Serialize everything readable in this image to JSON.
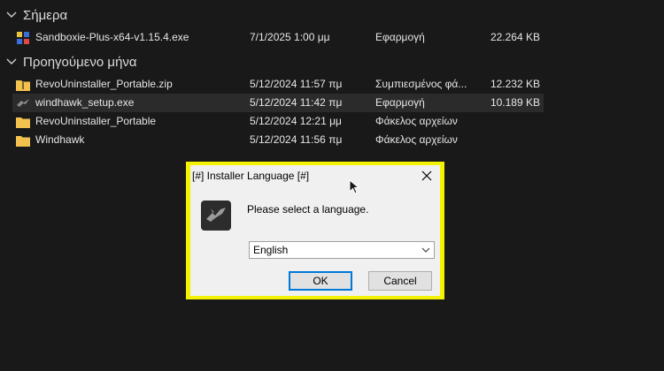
{
  "groups": [
    {
      "label": "Σήμερα",
      "files": [
        {
          "icon": "sandboxie-app-icon",
          "name": "Sandboxie-Plus-x64-v1.15.4.exe",
          "date": "7/1/2025 1:00 μμ",
          "type": "Εφαρμογή",
          "size": "22.264 KB"
        }
      ]
    },
    {
      "label": "Προηγούμενο μήνα",
      "files": [
        {
          "icon": "zip-folder-icon",
          "name": "RevoUninstaller_Portable.zip",
          "date": "5/12/2024 11:57 πμ",
          "type": "Συμπιεσμένος φά...",
          "size": "12.232 KB"
        },
        {
          "icon": "windhawk-app-icon",
          "name": "windhawk_setup.exe",
          "date": "5/12/2024 11:42 πμ",
          "type": "Εφαρμογή",
          "size": "10.189 KB"
        },
        {
          "icon": "folder-icon",
          "name": "RevoUninstaller_Portable",
          "date": "5/12/2024 12:21 μμ",
          "type": "Φάκελος αρχείων",
          "size": ""
        },
        {
          "icon": "folder-icon",
          "name": "Windhawk",
          "date": "5/12/2024 11:56 πμ",
          "type": "Φάκελος αρχείων",
          "size": ""
        }
      ]
    }
  ],
  "dialog": {
    "title": "[#] Installer Language [#]",
    "prompt": "Please select a language.",
    "selected_language": "English",
    "ok_label": "OK",
    "cancel_label": "Cancel"
  },
  "colors": {
    "background": "#191919",
    "highlight_border": "#f4f200",
    "ok_focus": "#0078d7",
    "folder": "#f2c14e"
  }
}
